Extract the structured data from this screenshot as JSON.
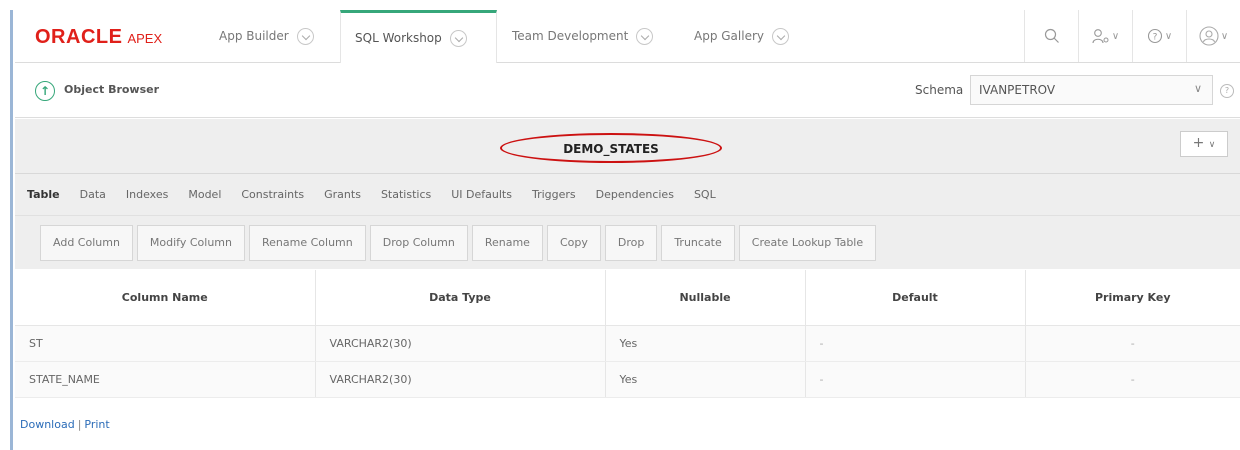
{
  "topnav": {
    "logo_oracle": "ORACLE",
    "logo_apex": "APEX",
    "tabs": [
      {
        "label": "App Builder"
      },
      {
        "label": "SQL Workshop"
      },
      {
        "label": "Team Development"
      },
      {
        "label": "App Gallery"
      }
    ],
    "active_tab": "SQL Workshop"
  },
  "obbar": {
    "title": "Object Browser",
    "schema_label": "Schema",
    "schema_value": "IVANPETROV"
  },
  "object": {
    "name": "DEMO_STATES"
  },
  "subtabs": [
    "Table",
    "Data",
    "Indexes",
    "Model",
    "Constraints",
    "Grants",
    "Statistics",
    "UI Defaults",
    "Triggers",
    "Dependencies",
    "SQL"
  ],
  "active_subtab": "Table",
  "actions": [
    "Add Column",
    "Modify Column",
    "Rename Column",
    "Drop Column",
    "Rename",
    "Copy",
    "Drop",
    "Truncate",
    "Create Lookup Table"
  ],
  "table": {
    "headers": [
      "Column Name",
      "Data Type",
      "Nullable",
      "Default",
      "Primary Key"
    ],
    "rows": [
      [
        "ST",
        "VARCHAR2(30)",
        "Yes",
        "-",
        "-"
      ],
      [
        "STATE_NAME",
        "VARCHAR2(30)",
        "Yes",
        "-",
        "-"
      ]
    ]
  },
  "footer": {
    "download": "Download",
    "separator": "|",
    "print": "Print"
  },
  "colors": {
    "oracle_red": "#e0201a",
    "active_green": "#36a77a",
    "annotation_red": "#cc1111",
    "link_blue": "#2b6cb8"
  }
}
